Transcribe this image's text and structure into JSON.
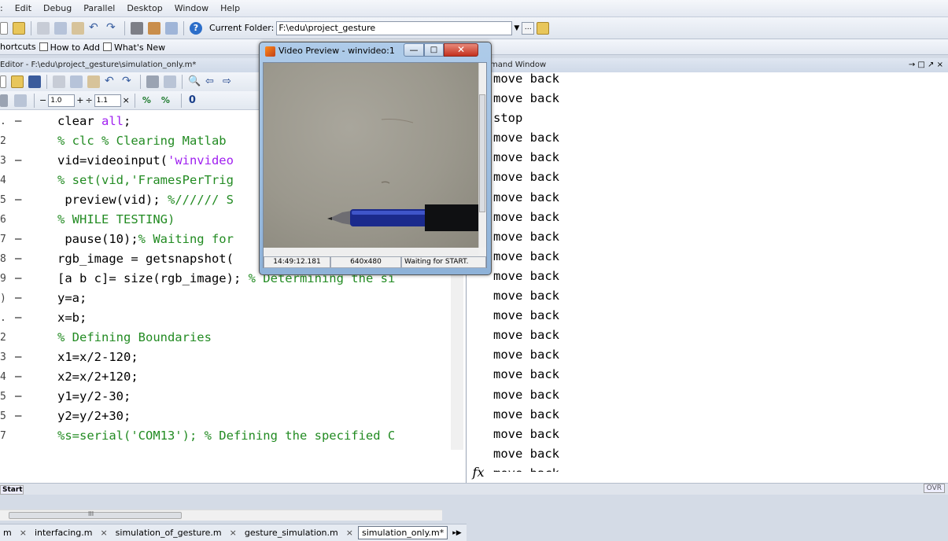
{
  "menubar": [
    "Edit",
    "Debug",
    "Parallel",
    "Desktop",
    "Window",
    "Help"
  ],
  "toolbar": {
    "current_folder_label": "Current Folder:",
    "current_folder_value": "F:\\edu\\project_gesture"
  },
  "shortcuts": {
    "item1": "hortcuts",
    "item2": "How to Add",
    "item3": "What's New"
  },
  "editor": {
    "title": "Editor - F:\\edu\\project_gesture\\simulation_only.m*",
    "cell_value1": "1.0",
    "cell_value2": "1.1",
    "lines": [
      {
        "ln": ".",
        "bp": "—",
        "html": "clear <span class=\"str\">all</span>;"
      },
      {
        "ln": "2",
        "bp": "",
        "html": "<span class=\"com\">% clc % Clearing Matlab </span>"
      },
      {
        "ln": "3",
        "bp": "—",
        "html": "vid=videoinput(<span class=\"str\">'winvideo</span>"
      },
      {
        "ln": "4",
        "bp": "",
        "html": "<span class=\"com\">% set(vid,'FramesPerTrig</span>"
      },
      {
        "ln": "5",
        "bp": "—",
        "html": " preview(vid); <span class=\"com\">%////// S</span>"
      },
      {
        "ln": "6",
        "bp": "",
        "html": "<span class=\"com\">% WHILE TESTING)</span>"
      },
      {
        "ln": "7",
        "bp": "—",
        "html": " pause(10);<span class=\"com\">% Waiting for</span>"
      },
      {
        "ln": "8",
        "bp": "—",
        "html": "rgb_image = getsnapshot("
      },
      {
        "ln": "9",
        "bp": "—",
        "html": "[a b c]= size(rgb_image); <span class=\"com\">% Determining the si</span>"
      },
      {
        "ln": ")",
        "bp": "—",
        "html": "y=a;"
      },
      {
        "ln": ".",
        "bp": "—",
        "html": "x=b;"
      },
      {
        "ln": "2",
        "bp": "",
        "html": "<span class=\"com\">% Defining Boundaries</span>"
      },
      {
        "ln": "3",
        "bp": "—",
        "html": "x1=x/2-120;"
      },
      {
        "ln": "4",
        "bp": "—",
        "html": "x2=x/2+120;"
      },
      {
        "ln": "5",
        "bp": "—",
        "html": "y1=y/2-30;"
      },
      {
        "ln": "5",
        "bp": "—",
        "html": "y2=y/2+30;"
      },
      {
        "ln": "7",
        "bp": "",
        "html": "<span class=\"com\">%s=serial('COM13'); % Defining the specified C</span>"
      }
    ],
    "scroll_marker": "III",
    "tabs": [
      "m",
      "interfacing.m",
      "simulation_of_gesture.m",
      "gesture_simulation.m",
      "simulation_only.m*"
    ]
  },
  "command_window": {
    "title": "mand Window",
    "controls": "→ □ ↗ ×",
    "fx": "fx",
    "lines": [
      "move back",
      "move back",
      "stop",
      "move back",
      "move back",
      "move back",
      "move back",
      "move back",
      "move back",
      "move back",
      "move back",
      "move back",
      "move back",
      "move back",
      "move back",
      "move back",
      "move back",
      "move back",
      "move back",
      "move back",
      "move back"
    ]
  },
  "video_preview": {
    "title": "Video Preview - winvideo:1",
    "timestamp": "14:49:12.181",
    "resolution": "640x480",
    "status": "Waiting for START."
  },
  "statusbar": {
    "left": "Start",
    "right": "OVR"
  },
  "colors": {
    "keyword": "#0000ff",
    "string": "#a020f0",
    "comment": "#228b22"
  }
}
